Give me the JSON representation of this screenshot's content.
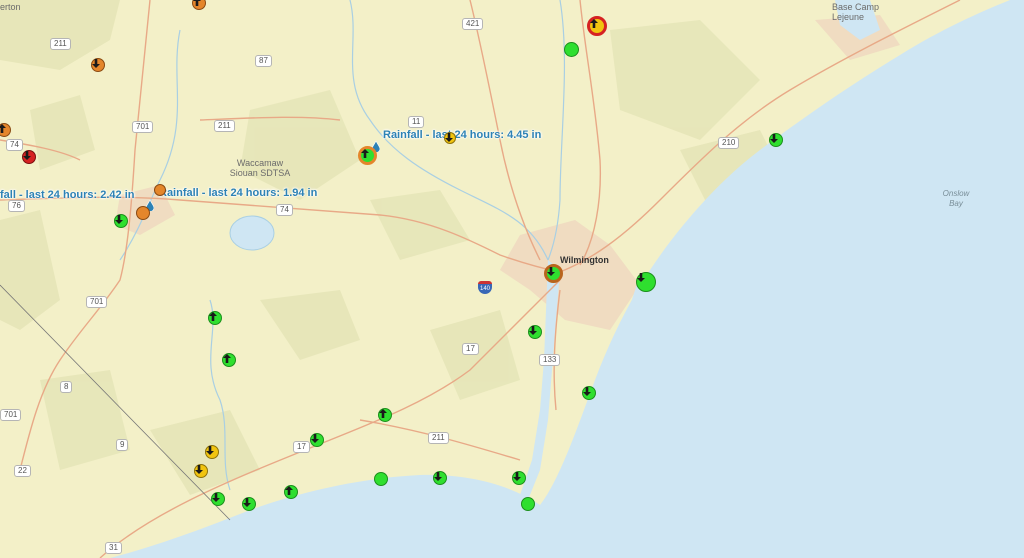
{
  "map": {
    "places": {
      "base_camp": "Base Camp\nLejeune",
      "waccamaw": "Waccamaw\nSiouan SDTSA",
      "wilmington": "Wilmington",
      "onslow_bay": "Onslow\nBay",
      "erton": "erton"
    },
    "route_shields": [
      "211",
      "87",
      "421",
      "701",
      "211",
      "11",
      "74",
      "76",
      "74",
      "210",
      "701",
      "17",
      "133",
      "8",
      "701",
      "9",
      "211",
      "17",
      "22",
      "31"
    ],
    "interstate": "140",
    "rainfall_labels": [
      "Rainfall - last 24 hours: 4.45 in",
      "Rainfall - last 24 hours: 1.94 in",
      "fall - last 24 hours: 2.42 in"
    ],
    "gauges": [
      {
        "color": "orange",
        "arrow": "up"
      },
      {
        "color": "orange",
        "arrow": "down"
      },
      {
        "color": "orange",
        "arrow": "up"
      },
      {
        "color": "red",
        "arrow": "down"
      },
      {
        "color": "ring-red",
        "arrow": "up"
      },
      {
        "color": "green",
        "arrow": "none"
      },
      {
        "color": "yellow",
        "arrow": "down"
      },
      {
        "color": "ring-orange",
        "arrow": "up"
      },
      {
        "color": "orange",
        "arrow": "none"
      },
      {
        "color": "orange",
        "arrow": "none"
      },
      {
        "color": "green",
        "arrow": "down"
      },
      {
        "color": "green",
        "arrow": "down"
      },
      {
        "color": "ring-darkorange",
        "arrow": "down"
      },
      {
        "color": "green",
        "arrow": "down"
      },
      {
        "color": "green",
        "arrow": "up"
      },
      {
        "color": "green",
        "arrow": "up"
      },
      {
        "color": "green",
        "arrow": "down"
      },
      {
        "color": "green",
        "arrow": "down"
      },
      {
        "color": "green",
        "arrow": "up"
      },
      {
        "color": "green",
        "arrow": "down"
      },
      {
        "color": "yellow",
        "arrow": "down"
      },
      {
        "color": "yellow",
        "arrow": "down"
      },
      {
        "color": "green",
        "arrow": "down"
      },
      {
        "color": "green",
        "arrow": "down"
      },
      {
        "color": "green",
        "arrow": "up"
      },
      {
        "color": "green",
        "arrow": "none"
      },
      {
        "color": "green",
        "arrow": "down"
      },
      {
        "color": "green",
        "arrow": "down"
      },
      {
        "color": "green",
        "arrow": "none"
      }
    ],
    "colors": {
      "land": "#f3f0c8",
      "water": "#cfe6f3",
      "green": "#2fdf2f",
      "orange": "#e4862b",
      "red": "#d62222",
      "yellow": "#f1c40f",
      "label": "#2d82b5"
    }
  }
}
